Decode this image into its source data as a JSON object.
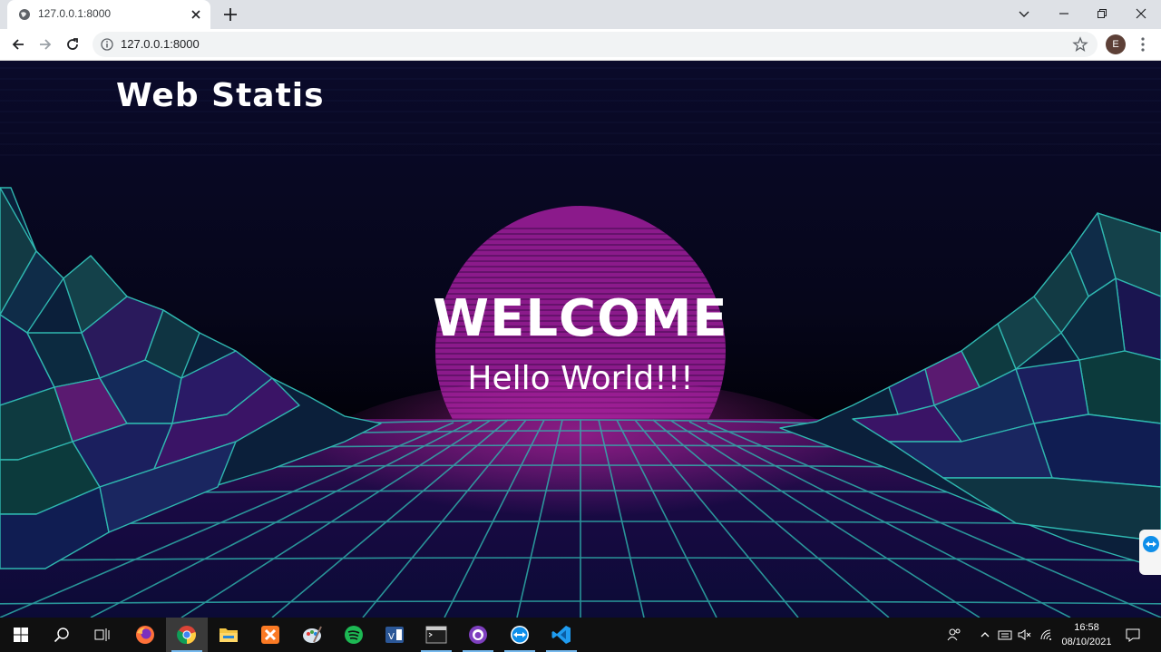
{
  "browser": {
    "tab_title": "127.0.0.1:8000",
    "url": "127.0.0.1:8000",
    "profile_initial": "E"
  },
  "page": {
    "brand": "Web Statis",
    "headline": "WELCOME",
    "subheadline": "Hello World!!!"
  },
  "taskbar": {
    "apps": [
      "windows-start",
      "search",
      "task-view",
      "firefox",
      "chrome",
      "file-explorer",
      "xampp",
      "paint",
      "spotify",
      "visual-studio",
      "terminal",
      "github-desktop",
      "teamviewer",
      "vscode"
    ],
    "time": "16:58",
    "date": "08/10/2021"
  },
  "colors": {
    "sun": "#8b1a8b",
    "grid_line": "#2fb7b0",
    "sky_top": "#0a0a2a",
    "taskbar": "#101010"
  }
}
